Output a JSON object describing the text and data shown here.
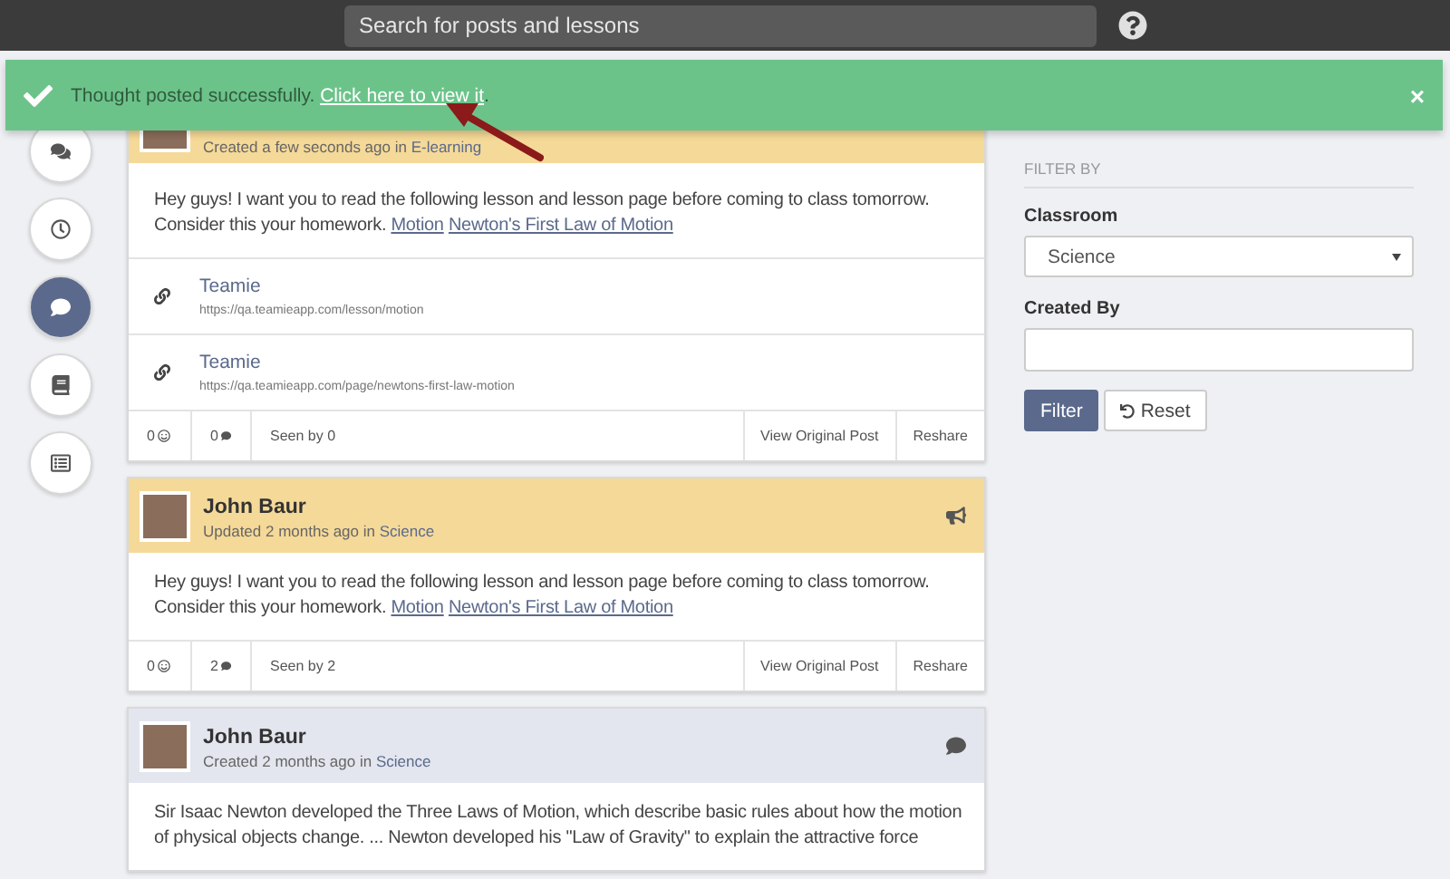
{
  "topbar": {
    "search": {
      "placeholder": "Search for posts and lessons"
    }
  },
  "toast": {
    "message": "Thought posted successfully.",
    "link": "Click here to view it",
    "suffix": ".",
    "close": "×"
  },
  "sidebar": {
    "items": [
      {
        "kind": "comments",
        "selected": false
      },
      {
        "kind": "clock",
        "selected": false
      },
      {
        "kind": "comment",
        "selected": true
      },
      {
        "kind": "book",
        "selected": false
      },
      {
        "kind": "list",
        "selected": false
      }
    ]
  },
  "posts": [
    {
      "highlighted": true,
      "meta": "Created a few seconds ago in",
      "classroom": "E-learning",
      "body": {
        "lines": [
          "Hey guys! I want you to read the following lesson and lesson page before coming to class tomorrow.",
          "Consider this your homework."
        ],
        "links": [
          "Motion",
          "Newton's First Law of Motion"
        ]
      },
      "attachments": [
        {
          "title": "Teamie",
          "url": "https://qa.teamieapp.com/lesson/motion"
        },
        {
          "title": "Teamie",
          "url": "https://qa.teamieapp.com/page/newtons-first-law-motion"
        }
      ],
      "footer": {
        "reactions": "0",
        "comments": "0",
        "seen": "Seen by 0",
        "view": "View Original Post",
        "reshare": "Reshare"
      }
    },
    {
      "highlighted": true,
      "kind": "announcement",
      "author": "John Baur",
      "meta": "Updated 2 months ago in",
      "classroom": "Science",
      "body": {
        "lines": [
          "Hey guys! I want you to read the following lesson and lesson page before coming to class tomorrow.",
          "Consider this your homework."
        ],
        "links": [
          "Motion",
          "Newton's First Law of Motion"
        ]
      },
      "footer": {
        "reactions": "0",
        "comments": "2",
        "seen": "Seen by 2",
        "view": "View Original Post",
        "reshare": "Reshare"
      }
    },
    {
      "highlighted": false,
      "kind": "thought",
      "author": "John Baur",
      "meta": "Created 2 months ago in",
      "classroom": "Science",
      "body": {
        "lines": [
          "Sir Isaac Newton developed the Three Laws of Motion, which describe basic rules about how the motion",
          "of physical objects change. ... Newton developed his \"Law of Gravity\" to explain the attractive force"
        ]
      }
    }
  ],
  "filter": {
    "heading": "FILTER BY",
    "classroom_label": "Classroom",
    "classroom_value": "Science",
    "created_by_label": "Created By",
    "filter_button": "Filter",
    "reset_button": "Reset"
  }
}
